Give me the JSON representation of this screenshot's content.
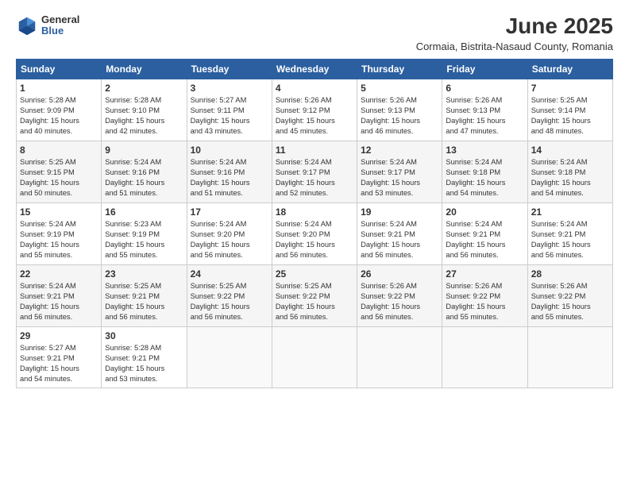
{
  "header": {
    "logo": {
      "general": "General",
      "blue": "Blue"
    },
    "title": "June 2025",
    "location": "Cormaia, Bistrita-Nasaud County, Romania"
  },
  "calendar": {
    "headers": [
      "Sunday",
      "Monday",
      "Tuesday",
      "Wednesday",
      "Thursday",
      "Friday",
      "Saturday"
    ],
    "rows": [
      [
        {
          "day": "1",
          "text": "Sunrise: 5:28 AM\nSunset: 9:09 PM\nDaylight: 15 hours\nand 40 minutes."
        },
        {
          "day": "2",
          "text": "Sunrise: 5:28 AM\nSunset: 9:10 PM\nDaylight: 15 hours\nand 42 minutes."
        },
        {
          "day": "3",
          "text": "Sunrise: 5:27 AM\nSunset: 9:11 PM\nDaylight: 15 hours\nand 43 minutes."
        },
        {
          "day": "4",
          "text": "Sunrise: 5:26 AM\nSunset: 9:12 PM\nDaylight: 15 hours\nand 45 minutes."
        },
        {
          "day": "5",
          "text": "Sunrise: 5:26 AM\nSunset: 9:13 PM\nDaylight: 15 hours\nand 46 minutes."
        },
        {
          "day": "6",
          "text": "Sunrise: 5:26 AM\nSunset: 9:13 PM\nDaylight: 15 hours\nand 47 minutes."
        },
        {
          "day": "7",
          "text": "Sunrise: 5:25 AM\nSunset: 9:14 PM\nDaylight: 15 hours\nand 48 minutes."
        }
      ],
      [
        {
          "day": "8",
          "text": "Sunrise: 5:25 AM\nSunset: 9:15 PM\nDaylight: 15 hours\nand 50 minutes."
        },
        {
          "day": "9",
          "text": "Sunrise: 5:24 AM\nSunset: 9:16 PM\nDaylight: 15 hours\nand 51 minutes."
        },
        {
          "day": "10",
          "text": "Sunrise: 5:24 AM\nSunset: 9:16 PM\nDaylight: 15 hours\nand 51 minutes."
        },
        {
          "day": "11",
          "text": "Sunrise: 5:24 AM\nSunset: 9:17 PM\nDaylight: 15 hours\nand 52 minutes."
        },
        {
          "day": "12",
          "text": "Sunrise: 5:24 AM\nSunset: 9:17 PM\nDaylight: 15 hours\nand 53 minutes."
        },
        {
          "day": "13",
          "text": "Sunrise: 5:24 AM\nSunset: 9:18 PM\nDaylight: 15 hours\nand 54 minutes."
        },
        {
          "day": "14",
          "text": "Sunrise: 5:24 AM\nSunset: 9:18 PM\nDaylight: 15 hours\nand 54 minutes."
        }
      ],
      [
        {
          "day": "15",
          "text": "Sunrise: 5:24 AM\nSunset: 9:19 PM\nDaylight: 15 hours\nand 55 minutes."
        },
        {
          "day": "16",
          "text": "Sunrise: 5:23 AM\nSunset: 9:19 PM\nDaylight: 15 hours\nand 55 minutes."
        },
        {
          "day": "17",
          "text": "Sunrise: 5:24 AM\nSunset: 9:20 PM\nDaylight: 15 hours\nand 56 minutes."
        },
        {
          "day": "18",
          "text": "Sunrise: 5:24 AM\nSunset: 9:20 PM\nDaylight: 15 hours\nand 56 minutes."
        },
        {
          "day": "19",
          "text": "Sunrise: 5:24 AM\nSunset: 9:21 PM\nDaylight: 15 hours\nand 56 minutes."
        },
        {
          "day": "20",
          "text": "Sunrise: 5:24 AM\nSunset: 9:21 PM\nDaylight: 15 hours\nand 56 minutes."
        },
        {
          "day": "21",
          "text": "Sunrise: 5:24 AM\nSunset: 9:21 PM\nDaylight: 15 hours\nand 56 minutes."
        }
      ],
      [
        {
          "day": "22",
          "text": "Sunrise: 5:24 AM\nSunset: 9:21 PM\nDaylight: 15 hours\nand 56 minutes."
        },
        {
          "day": "23",
          "text": "Sunrise: 5:25 AM\nSunset: 9:21 PM\nDaylight: 15 hours\nand 56 minutes."
        },
        {
          "day": "24",
          "text": "Sunrise: 5:25 AM\nSunset: 9:22 PM\nDaylight: 15 hours\nand 56 minutes."
        },
        {
          "day": "25",
          "text": "Sunrise: 5:25 AM\nSunset: 9:22 PM\nDaylight: 15 hours\nand 56 minutes."
        },
        {
          "day": "26",
          "text": "Sunrise: 5:26 AM\nSunset: 9:22 PM\nDaylight: 15 hours\nand 56 minutes."
        },
        {
          "day": "27",
          "text": "Sunrise: 5:26 AM\nSunset: 9:22 PM\nDaylight: 15 hours\nand 55 minutes."
        },
        {
          "day": "28",
          "text": "Sunrise: 5:26 AM\nSunset: 9:22 PM\nDaylight: 15 hours\nand 55 minutes."
        }
      ],
      [
        {
          "day": "29",
          "text": "Sunrise: 5:27 AM\nSunset: 9:21 PM\nDaylight: 15 hours\nand 54 minutes."
        },
        {
          "day": "30",
          "text": "Sunrise: 5:28 AM\nSunset: 9:21 PM\nDaylight: 15 hours\nand 53 minutes."
        },
        {
          "day": "",
          "text": ""
        },
        {
          "day": "",
          "text": ""
        },
        {
          "day": "",
          "text": ""
        },
        {
          "day": "",
          "text": ""
        },
        {
          "day": "",
          "text": ""
        }
      ]
    ]
  }
}
